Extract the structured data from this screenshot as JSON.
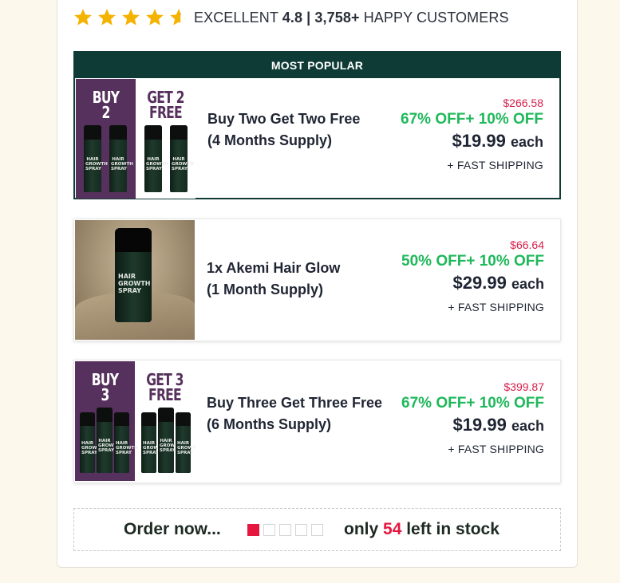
{
  "rating": {
    "stars_filled": 4.5,
    "stars_total": 5,
    "label": "EXCELLENT",
    "score": "4.8",
    "separator": "|",
    "customers_count": "3,758+",
    "customers_label": "HAPPY CUSTOMERS"
  },
  "offers": [
    {
      "ribbon": "MOST POPULAR",
      "thumb_left": "BUY 2",
      "thumb_right": "GET 2 FREE",
      "title_line1": "Buy Two Get Two Free",
      "title_line2": "(4 Months Supply)",
      "old_price": "$266.58",
      "discount": "67% OFF+ 10% OFF",
      "price": "$19.99",
      "price_unit": "each",
      "shipping": "+ FAST SHIPPING"
    },
    {
      "title_line1": "1x Akemi Hair Glow",
      "title_line2": "(1 Month Supply)",
      "old_price": "$66.64",
      "discount": "50% OFF+ 10% OFF",
      "price": "$29.99",
      "price_unit": "each",
      "shipping": "+ FAST SHIPPING"
    },
    {
      "thumb_left": "BUY 3",
      "thumb_right": "GET 3 FREE",
      "title_line1": "Buy Three Get Three Free",
      "title_line2": "(6 Months Supply)",
      "old_price": "$399.87",
      "discount": "67% OFF+ 10% OFF",
      "price": "$19.99",
      "price_unit": "each",
      "shipping": "+ FAST SHIPPING"
    }
  ],
  "product_label": "HAIR GROWTH SPRAY",
  "stock": {
    "order_now": "Order now...",
    "meter_filled": 1,
    "meter_total": 5,
    "prefix": "only",
    "count": "54",
    "suffix": "left in stock"
  },
  "colors": {
    "star": "#f5b301",
    "brand_dark": "#0f3b36",
    "purple": "#57315d",
    "discount_green": "#1fb85a",
    "old_price_red": "#d61f4a",
    "stock_red": "#e5173f"
  }
}
